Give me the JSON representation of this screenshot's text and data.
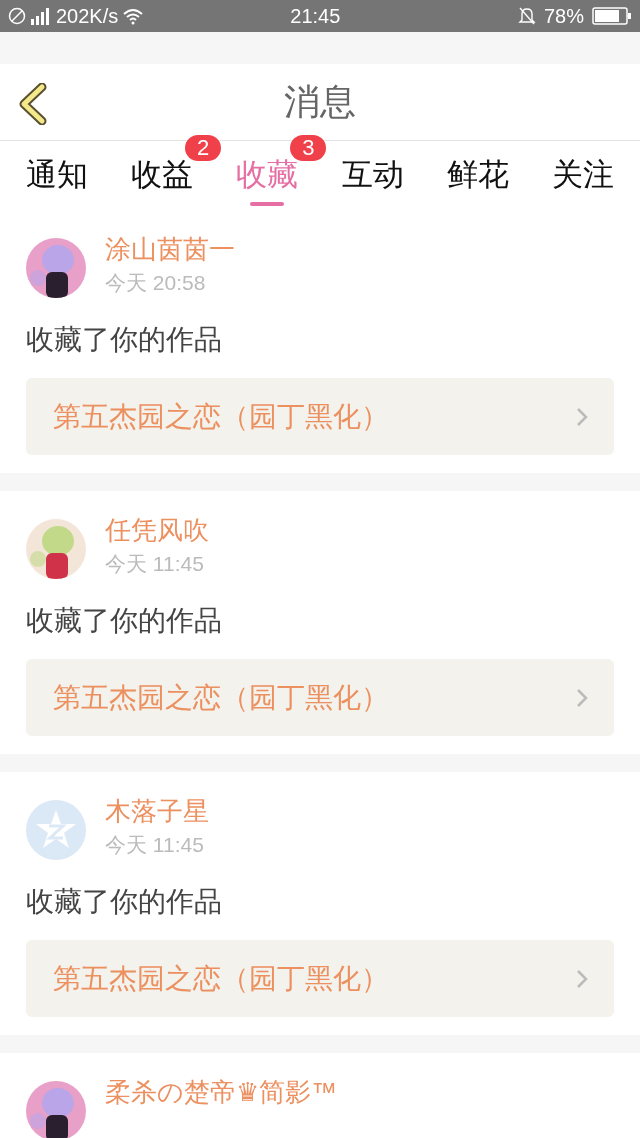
{
  "status_bar": {
    "network_speed": "202K/s",
    "time": "21:45",
    "battery": "78%"
  },
  "header": {
    "title": "消息"
  },
  "tabs": [
    {
      "label": "通知",
      "selected": false
    },
    {
      "label": "收益",
      "selected": false,
      "badge": "2"
    },
    {
      "label": "收藏",
      "selected": true,
      "badge": "3"
    },
    {
      "label": "互动",
      "selected": false
    },
    {
      "label": "鲜花",
      "selected": false
    },
    {
      "label": "关注",
      "selected": false
    }
  ],
  "messages": [
    {
      "user": "涂山茵茵一",
      "time": "今天 20:58",
      "action": "收藏了你的作品",
      "work": "第五杰园之恋（园丁黑化）"
    },
    {
      "user": "任凭风吹",
      "time": "今天 11:45",
      "action": "收藏了你的作品",
      "work": "第五杰园之恋（园丁黑化）"
    },
    {
      "user": "木落子星",
      "avatar": {
        "kind": "default"
      },
      "time": "今天 11:45",
      "action": "收藏了你的作品",
      "work": "第五杰园之恋（园丁黑化）"
    },
    {
      "user": "柔杀の楚帝♛简影™"
    }
  ]
}
